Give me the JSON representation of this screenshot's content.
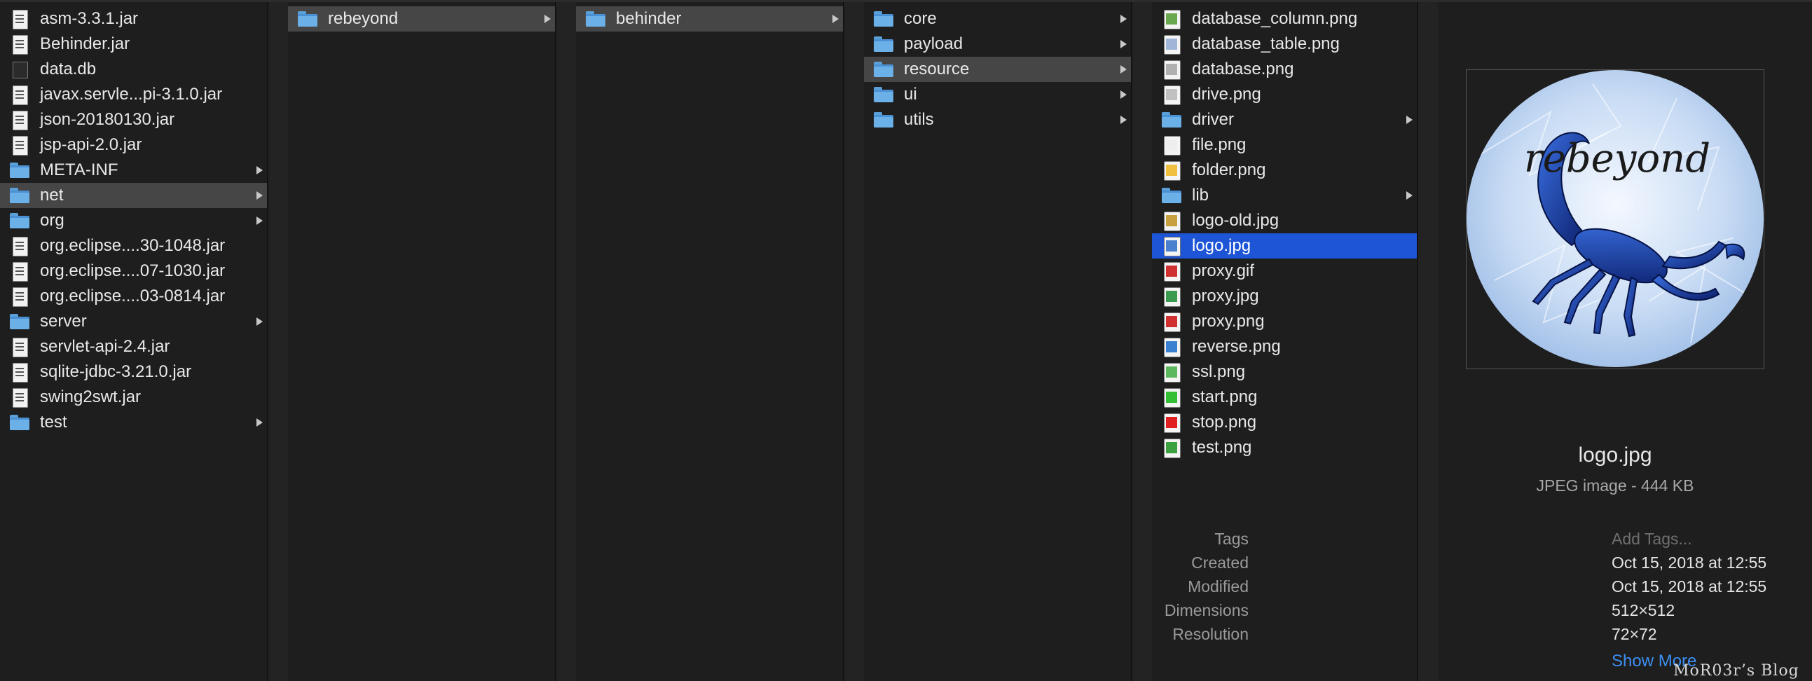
{
  "columns": [
    {
      "items": [
        {
          "label": "asm-3.3.1.jar",
          "icon": "jar-file-icon",
          "folder": false
        },
        {
          "label": "Behinder.jar",
          "icon": "jar-file-icon",
          "folder": false
        },
        {
          "label": "data.db",
          "icon": "database-file-icon",
          "folder": false
        },
        {
          "label": "javax.servle...pi-3.1.0.jar",
          "icon": "jar-file-icon",
          "folder": false
        },
        {
          "label": "json-20180130.jar",
          "icon": "jar-file-icon",
          "folder": false
        },
        {
          "label": "jsp-api-2.0.jar",
          "icon": "jar-file-icon",
          "folder": false
        },
        {
          "label": "META-INF",
          "icon": "folder-icon",
          "folder": true
        },
        {
          "label": "net",
          "icon": "folder-icon",
          "folder": true,
          "selected": "gray"
        },
        {
          "label": "org",
          "icon": "folder-icon",
          "folder": true
        },
        {
          "label": "org.eclipse....30-1048.jar",
          "icon": "jar-file-icon",
          "folder": false
        },
        {
          "label": "org.eclipse....07-1030.jar",
          "icon": "jar-file-icon",
          "folder": false
        },
        {
          "label": "org.eclipse....03-0814.jar",
          "icon": "jar-file-icon",
          "folder": false
        },
        {
          "label": "server",
          "icon": "folder-icon",
          "folder": true
        },
        {
          "label": "servlet-api-2.4.jar",
          "icon": "jar-file-icon",
          "folder": false
        },
        {
          "label": "sqlite-jdbc-3.21.0.jar",
          "icon": "jar-file-icon",
          "folder": false
        },
        {
          "label": "swing2swt.jar",
          "icon": "jar-file-icon",
          "folder": false
        },
        {
          "label": "test",
          "icon": "folder-icon",
          "folder": true
        }
      ]
    },
    {
      "items": [
        {
          "label": "rebeyond",
          "icon": "folder-icon",
          "folder": true,
          "selected": "gray"
        }
      ]
    },
    {
      "items": [
        {
          "label": "behinder",
          "icon": "folder-icon",
          "folder": true,
          "selected": "gray"
        }
      ]
    },
    {
      "items": [
        {
          "label": "core",
          "icon": "folder-icon",
          "folder": true
        },
        {
          "label": "payload",
          "icon": "folder-icon",
          "folder": true
        },
        {
          "label": "resource",
          "icon": "folder-icon",
          "folder": true,
          "selected": "gray"
        },
        {
          "label": "ui",
          "icon": "folder-icon",
          "folder": true
        },
        {
          "label": "utils",
          "icon": "folder-icon",
          "folder": true
        }
      ]
    },
    {
      "items": [
        {
          "label": "database_column.png",
          "icon": "image-file-icon",
          "folder": false,
          "color": "#6aa84f"
        },
        {
          "label": "database_table.png",
          "icon": "image-file-icon",
          "folder": false,
          "color": "#9fb6d9"
        },
        {
          "label": "database.png",
          "icon": "image-file-icon",
          "folder": false,
          "color": "#b0b0b0"
        },
        {
          "label": "drive.png",
          "icon": "image-file-icon",
          "folder": false,
          "color": "#c0c0c0"
        },
        {
          "label": "driver",
          "icon": "folder-icon",
          "folder": true
        },
        {
          "label": "file.png",
          "icon": "image-file-icon",
          "folder": false,
          "color": "#eeeeee"
        },
        {
          "label": "folder.png",
          "icon": "image-file-icon",
          "folder": false,
          "color": "#f0c040"
        },
        {
          "label": "lib",
          "icon": "folder-icon",
          "folder": true
        },
        {
          "label": "logo-old.jpg",
          "icon": "image-file-icon",
          "folder": false,
          "color": "#c8a040"
        },
        {
          "label": "logo.jpg",
          "icon": "image-file-icon",
          "folder": false,
          "color": "#4a7fd0",
          "selected": "blue"
        },
        {
          "label": "proxy.gif",
          "icon": "image-file-icon",
          "folder": false,
          "color": "#d03030"
        },
        {
          "label": "proxy.jpg",
          "icon": "image-file-icon",
          "folder": false,
          "color": "#3a9a50"
        },
        {
          "label": "proxy.png",
          "icon": "image-file-icon",
          "folder": false,
          "color": "#d03030"
        },
        {
          "label": "reverse.png",
          "icon": "image-file-icon",
          "folder": false,
          "color": "#3a80d0"
        },
        {
          "label": "ssl.png",
          "icon": "image-file-icon",
          "folder": false,
          "color": "#5cb85c"
        },
        {
          "label": "start.png",
          "icon": "image-file-icon",
          "folder": false,
          "color": "#34c034"
        },
        {
          "label": "stop.png",
          "icon": "image-file-icon",
          "folder": false,
          "color": "#e02020"
        },
        {
          "label": "test.png",
          "icon": "image-file-icon",
          "folder": false,
          "color": "#3aa040"
        }
      ]
    }
  ],
  "preview": {
    "image_text": "rebeyond",
    "file_name": "logo.jpg",
    "kind": "JPEG image - 444 KB",
    "tags_label": "Tags",
    "tags_placeholder": "Add Tags...",
    "created_label": "Created",
    "created_value": "Oct 15, 2018 at 12:55",
    "modified_label": "Modified",
    "modified_value": "Oct 15, 2018 at 12:55",
    "dimensions_label": "Dimensions",
    "dimensions_value": "512×512",
    "resolution_label": "Resolution",
    "resolution_value": "72×72",
    "show_more": "Show More"
  },
  "watermark": "MoR03r’s Blog",
  "colors": {
    "background": "#1e1e1e",
    "selection_blue": "#1e54d6",
    "selection_gray": "#464646",
    "folder_blue": "#6cb0e8",
    "link_blue": "#3d8ef2"
  }
}
